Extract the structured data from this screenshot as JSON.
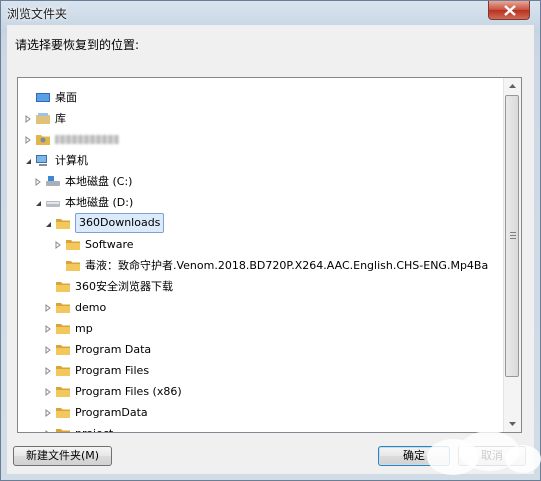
{
  "window": {
    "title": "浏览文件夹"
  },
  "prompt": "请选择要恢复到的位置:",
  "tree": [
    {
      "label": "桌面",
      "icon": "desktop-icon",
      "arrow": "none"
    },
    {
      "label": "库",
      "icon": "library-icon",
      "arrow": "collapsed"
    },
    {
      "label": "",
      "icon": "user-folder-icon",
      "arrow": "collapsed"
    },
    {
      "label": "计算机",
      "icon": "computer-icon",
      "arrow": "expanded"
    },
    {
      "label": "本地磁盘 (C:)",
      "icon": "system-drive-icon",
      "arrow": "collapsed"
    },
    {
      "label": "本地磁盘 (D:)",
      "icon": "drive-icon",
      "arrow": "expanded"
    },
    {
      "label": "360Downloads",
      "icon": "folder-icon",
      "arrow": "expanded",
      "selected": true
    },
    {
      "label": "Software",
      "icon": "folder-icon",
      "arrow": "collapsed"
    },
    {
      "label": "毒液：致命守护者.Venom.2018.BD720P.X264.AAC.English.CHS-ENG.Mp4Ba",
      "icon": "folder-icon",
      "arrow": "none"
    },
    {
      "label": "360安全浏览器下载",
      "icon": "folder-icon",
      "arrow": "none"
    },
    {
      "label": "demo",
      "icon": "folder-icon",
      "arrow": "collapsed"
    },
    {
      "label": "mp",
      "icon": "folder-icon",
      "arrow": "collapsed"
    },
    {
      "label": "Program Data",
      "icon": "folder-icon",
      "arrow": "collapsed"
    },
    {
      "label": "Program Files",
      "icon": "folder-icon",
      "arrow": "collapsed"
    },
    {
      "label": "Program Files (x86)",
      "icon": "folder-icon",
      "arrow": "collapsed"
    },
    {
      "label": "ProgramData",
      "icon": "folder-icon",
      "arrow": "collapsed"
    },
    {
      "label": "project",
      "icon": "folder-icon",
      "arrow": "collapsed"
    }
  ],
  "buttons": {
    "new_folder": "新建文件夹(M)",
    "ok": "确定",
    "cancel": "取消"
  },
  "colors": {
    "selection_bg": "#dcebfc",
    "selection_border": "#7da2ce",
    "folder": "#e8b94a"
  }
}
